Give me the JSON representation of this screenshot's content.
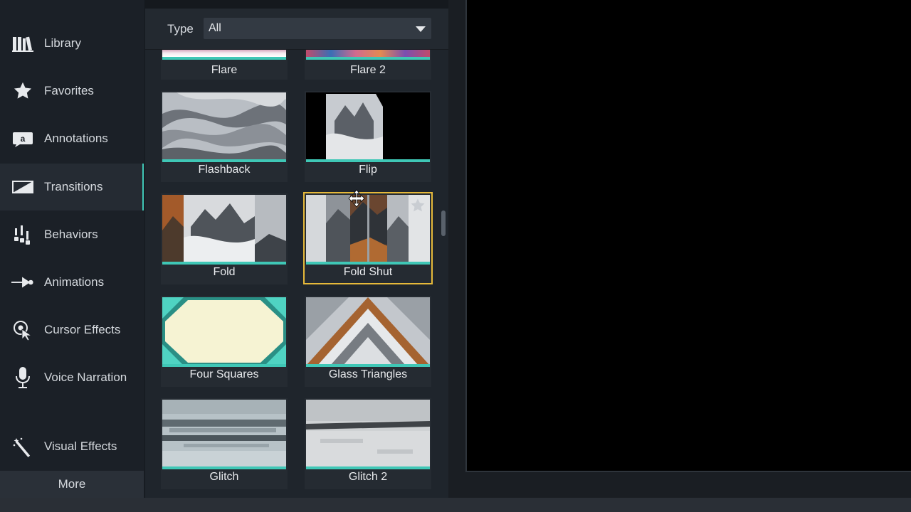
{
  "sidebar": {
    "items": [
      {
        "label": "Library",
        "icon": "library-icon"
      },
      {
        "label": "Favorites",
        "icon": "star-icon"
      },
      {
        "label": "Annotations",
        "icon": "annotation-icon"
      },
      {
        "label": "Transitions",
        "icon": "transition-icon"
      },
      {
        "label": "Behaviors",
        "icon": "behaviors-icon"
      },
      {
        "label": "Animations",
        "icon": "animation-icon"
      },
      {
        "label": "Cursor Effects",
        "icon": "cursor-effects-icon"
      },
      {
        "label": "Voice Narration",
        "icon": "microphone-icon"
      },
      {
        "label": "Visual Effects",
        "icon": "magic-wand-icon"
      }
    ],
    "active": "Transitions",
    "more_label": "More"
  },
  "filter": {
    "type_label": "Type",
    "type_value": "All"
  },
  "transitions": [
    {
      "name": "Flare"
    },
    {
      "name": "Flare 2"
    },
    {
      "name": "Flashback"
    },
    {
      "name": "Flip"
    },
    {
      "name": "Fold"
    },
    {
      "name": "Fold Shut",
      "selected": true
    },
    {
      "name": "Four Squares"
    },
    {
      "name": "Glass Triangles"
    },
    {
      "name": "Glitch"
    },
    {
      "name": "Glitch 2"
    }
  ],
  "colors": {
    "accent": "#3fc7b6",
    "selection": "#e6b93a",
    "sidebar_bg": "#1b2027",
    "canvas_bg": "#000000"
  }
}
